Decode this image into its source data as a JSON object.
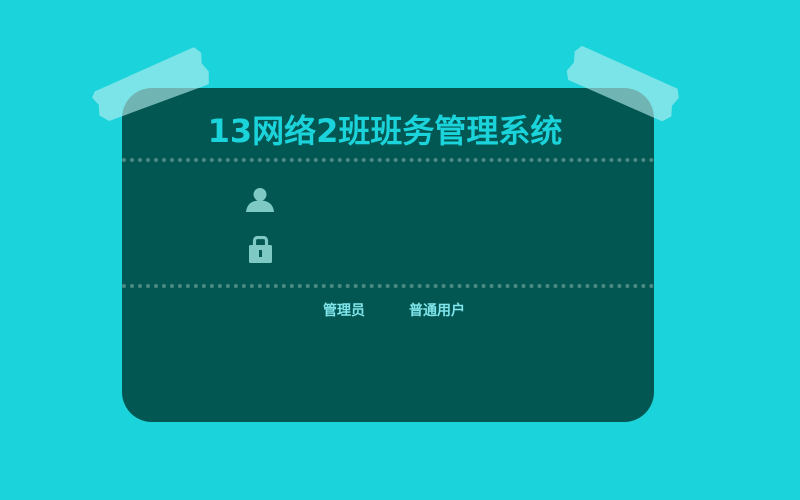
{
  "app": {
    "title": "13网络2班班务管理系统"
  },
  "login": {
    "username_icon": "user-icon",
    "password_icon": "lock-icon",
    "username_value": "",
    "password_value": ""
  },
  "roles": {
    "admin_label": "管理员",
    "user_label": "普通用户"
  },
  "colors": {
    "background": "#1bd4db",
    "card": "#035753",
    "accent": "#1bd4db",
    "icon": "#7fc9c5",
    "tape": "#b4eef0"
  }
}
